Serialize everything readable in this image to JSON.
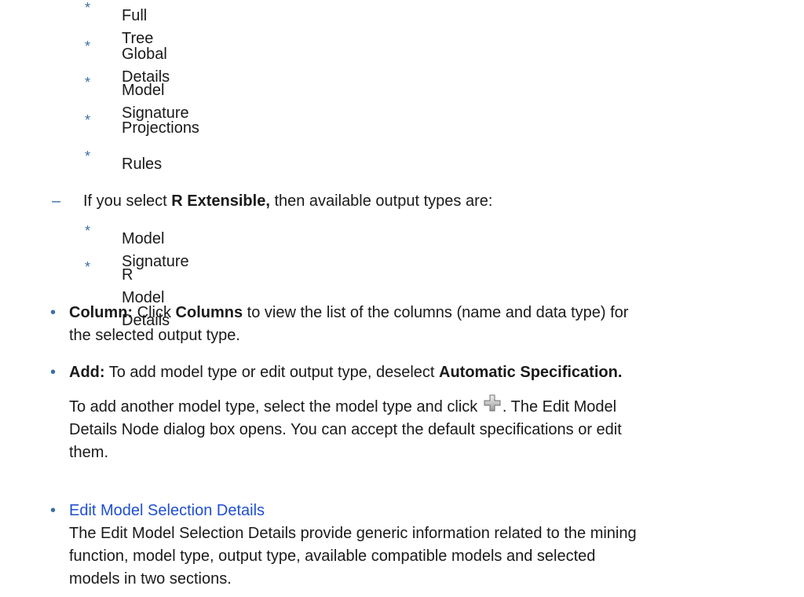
{
  "list_markers": {
    "star": "*",
    "dash": "–",
    "bullet": "•"
  },
  "level3_a": [
    "Full Tree",
    "Global Details",
    "Model Signature",
    "Projections",
    "Rules"
  ],
  "r_extensible": {
    "pre": "If you select ",
    "bold": "R Extensible,",
    "post": " then available output types are:",
    "items": [
      "Model Signature",
      "R Model Details"
    ]
  },
  "column_item": {
    "label": "Column:",
    "pre": " Click ",
    "bold": "Columns",
    "post_line1": " to view the list of the columns (name and data type) for",
    "line2": "the selected output type."
  },
  "add_item": {
    "label": "Add:",
    "pre": " To add model type or edit output type, deselect ",
    "bold": "Automatic Specification."
  },
  "add_para": {
    "line1_pre": "To add another model type, select the model type and click ",
    "line1_post": ". The Edit Model",
    "line2": "Details Node dialog box opens. You can accept the default specifications or edit",
    "line3": "them."
  },
  "edit_link": {
    "link": "Edit Model Selection Details",
    "desc_lines": [
      "The Edit Model Selection Details provide generic information related to the mining",
      "function, model type, output type, available compatible models and selected",
      "models in two sections."
    ]
  },
  "colors": {
    "marker": "#3a6ea5",
    "link": "#1f4fd1",
    "text": "#1a1a1a"
  },
  "icons": {
    "add": "plus-icon"
  }
}
